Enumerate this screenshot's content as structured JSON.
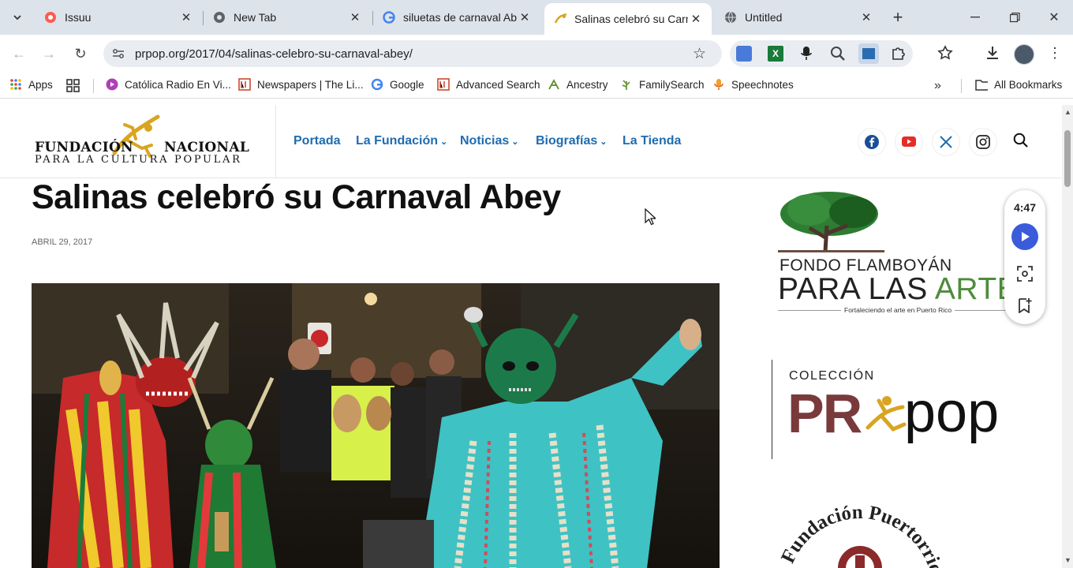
{
  "tabs": [
    {
      "title": "Issuu",
      "icon": "issuu-icon"
    },
    {
      "title": "New Tab",
      "icon": "chrome-icon"
    },
    {
      "title": "siluetas de carnaval Abey",
      "icon": "google-icon"
    },
    {
      "title": "Salinas celebró su Carnaval",
      "icon": "prpop-icon"
    },
    {
      "title": "Untitled",
      "icon": "globe-icon"
    }
  ],
  "url": "prpop.org/2017/04/salinas-celebro-su-carnaval-abey/",
  "bookmarks": [
    {
      "label": "Apps",
      "icon": "apps-grid-icon"
    },
    {
      "label": "Católica Radio En Vi...",
      "icon": "catolica-radio-icon"
    },
    {
      "label": "Newspapers | The Li...",
      "icon": "loc-icon"
    },
    {
      "label": "Google",
      "icon": "google-icon"
    },
    {
      "label": "Advanced Search",
      "icon": "loc-icon"
    },
    {
      "label": "Ancestry",
      "icon": "ancestry-icon"
    },
    {
      "label": "FamilySearch",
      "icon": "familysearch-icon"
    },
    {
      "label": "Speechnotes",
      "icon": "speechnotes-icon"
    }
  ],
  "all_bookmarks": "All Bookmarks",
  "site": {
    "logo_line1_left": "FUNDACIÓN",
    "logo_line1_right": "NACIONAL",
    "logo_line2": "PARA LA CULTURA POPULAR",
    "nav": [
      {
        "label": "Portada",
        "dropdown": false
      },
      {
        "label": "La Fundación",
        "dropdown": true
      },
      {
        "label": "Noticias",
        "dropdown": true
      },
      {
        "label": "Biografías",
        "dropdown": true
      },
      {
        "label": "La Tienda",
        "dropdown": false
      }
    ]
  },
  "article": {
    "title": "Salinas celebró su Carnaval Abey",
    "date": "ABRIL 29, 2017"
  },
  "sidebar": {
    "fondo_line1": "FONDO FLAMBOYÁN",
    "fondo_line2a": "PARA LAS ",
    "fondo_line2b": "ARTES",
    "fondo_tag": "Fortaleciendo el arte en Puerto Rico",
    "coleccion": "COLECCIÓN",
    "pr": "PR",
    "pop": "pop",
    "fundacion_arc": "Fundación Puertorriqueña"
  },
  "player": {
    "time": "4:47"
  },
  "colors": {
    "nav": "#1e6cb0",
    "accent_gold": "#d9a520",
    "pr_brown": "#7a3a3c",
    "artes_green": "#4f8c3a"
  }
}
